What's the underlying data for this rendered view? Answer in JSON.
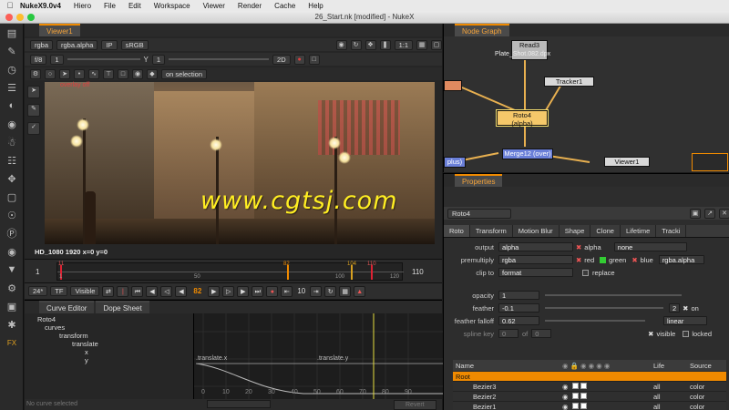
{
  "menubar": {
    "app_name": "NukeX9.0v4",
    "items": [
      "Hiero",
      "File",
      "Edit",
      "Workspace",
      "Viewer",
      "Render",
      "Cache",
      "Help"
    ]
  },
  "window": {
    "title": "26_Start.nk [modified] - NukeX"
  },
  "viewer": {
    "tab": "Viewer1",
    "channels": "rgba",
    "channel_sub": "rgba.alpha",
    "ip_label": "IP",
    "colorspace": "sRGB",
    "zoom": "1:1",
    "fstop": "f/8",
    "gain_value": "1",
    "y_label": "Y",
    "gamma_value": "1",
    "view_mode": "2D",
    "roi_mode": "on selection",
    "overlay_text": "overlay off",
    "format_info": "HD_1080 1920",
    "coords": "x=0 y=0"
  },
  "timeline": {
    "start": "1",
    "end": "110",
    "ticks": [
      "1",
      "50",
      "100",
      "120"
    ],
    "markers": [
      "11",
      "82",
      "104",
      "110"
    ],
    "fps": "24*",
    "tf": "TF",
    "visible": "Visible",
    "current_frame": "82",
    "step": "10"
  },
  "curve_editor": {
    "tabs": [
      "Curve Editor",
      "Dope Sheet"
    ],
    "tree": [
      "Roto4",
      "curves",
      "transform",
      "translate",
      "x",
      "y"
    ],
    "curve_labels": [
      ".translate.x",
      ".translate.y"
    ],
    "axis_ticks": [
      "0",
      "10",
      "20",
      "30",
      "40",
      "50",
      "60",
      "70",
      "80",
      "90"
    ],
    "status": "No curve selected",
    "revert": "Revert"
  },
  "node_graph": {
    "tab": "Node Graph",
    "nodes": {
      "read": "Read3",
      "read_file": "Plate_Shot.082.dpx",
      "tracker": "Tracker1",
      "roto": "Roto4",
      "roto_sub": "(alpha)",
      "merge": "Merge12 (over)",
      "viewer": "Viewer1",
      "other": "plus)"
    }
  },
  "properties": {
    "tab": "Properties",
    "node_name": "Roto4",
    "tabs": [
      "Roto",
      "Transform",
      "Motion Blur",
      "Shape",
      "Clone",
      "Lifetime",
      "Tracki"
    ],
    "output": {
      "label": "output",
      "value": "alpha",
      "chk": "alpha",
      "mask": "none"
    },
    "premultiply": {
      "label": "premultiply",
      "value": "rgba",
      "r": "red",
      "g": "green",
      "b": "blue",
      "a": "rgba.alpha"
    },
    "clip_to": {
      "label": "clip to",
      "value": "format",
      "replace": "replace"
    },
    "opacity": {
      "label": "opacity",
      "value": "1"
    },
    "feather": {
      "label": "feather",
      "value": "-0.1",
      "on": "on",
      "num": "2"
    },
    "feather_falloff": {
      "label": "feather falloff",
      "value": "0.62",
      "interp": "linear"
    },
    "spline_key": {
      "label": "spline key",
      "value": "0",
      "of": "of",
      "total": "0",
      "visible": "visible",
      "locked": "locked"
    },
    "layers_header": [
      "Name",
      "Life",
      "Source"
    ],
    "layers": [
      {
        "name": "Root",
        "life": "",
        "source": ""
      },
      {
        "name": "Bezier3",
        "life": "all",
        "source": "color"
      },
      {
        "name": "Bezier2",
        "life": "all",
        "source": "color"
      },
      {
        "name": "Bezier1",
        "life": "all",
        "source": "color"
      }
    ]
  },
  "watermark": "www.cgtsj.com",
  "colors": {
    "accent": "#f08a00",
    "roto_node": "#f5c86a",
    "merge_node": "#6a7fd8",
    "tracker_node": "#d8d8d8"
  }
}
